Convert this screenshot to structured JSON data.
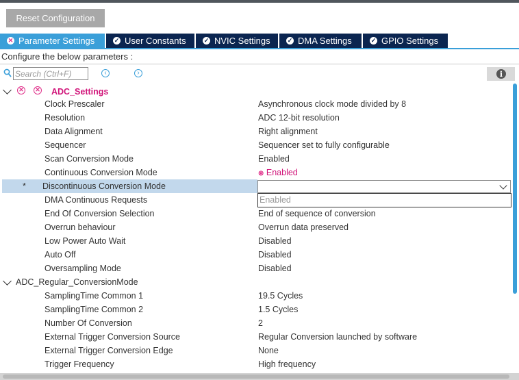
{
  "toolbar": {
    "reset_label": "Reset Configuration"
  },
  "tabs": [
    {
      "label": "Parameter Settings",
      "status": "error",
      "active": true
    },
    {
      "label": "User Constants",
      "status": "ok"
    },
    {
      "label": "NVIC Settings",
      "status": "ok"
    },
    {
      "label": "DMA Settings",
      "status": "ok"
    },
    {
      "label": "GPIO Settings",
      "status": "ok"
    }
  ],
  "config_label": "Configure the below parameters :",
  "search": {
    "placeholder": "Search (Ctrl+F)"
  },
  "groups": {
    "adc_settings": {
      "title": "ADC_Settings",
      "rows": [
        {
          "label": "Clock Prescaler",
          "value": "Asynchronous clock mode divided by 8"
        },
        {
          "label": "Resolution",
          "value": "ADC 12-bit resolution"
        },
        {
          "label": "Data Alignment",
          "value": "Right alignment"
        },
        {
          "label": "Sequencer",
          "value": "Sequencer set to fully configurable"
        },
        {
          "label": "Scan Conversion Mode",
          "value": "Enabled"
        },
        {
          "label": "Continuous Conversion Mode",
          "value": "Enabled"
        },
        {
          "label": "Discontinuous Conversion Mode",
          "value": "",
          "modified_marker": "*"
        },
        {
          "label": "DMA Continuous Requests",
          "value": ""
        },
        {
          "label": "End Of Conversion Selection",
          "value": "End of sequence of conversion"
        },
        {
          "label": "Overrun behaviour",
          "value": "Overrun data preserved"
        },
        {
          "label": "Low Power Auto Wait",
          "value": "Disabled"
        },
        {
          "label": "Auto Off",
          "value": "Disabled"
        },
        {
          "label": "Oversampling Mode",
          "value": "Disabled"
        }
      ]
    },
    "adc_regular": {
      "title": "ADC_Regular_ConversionMode",
      "rows": [
        {
          "label": "SamplingTime Common 1",
          "value": "19.5 Cycles"
        },
        {
          "label": "SamplingTime Common 2",
          "value": "1.5 Cycles"
        },
        {
          "label": "Number Of Conversion",
          "value": "2"
        },
        {
          "label": "External Trigger Conversion Source",
          "value": "Regular Conversion launched by software"
        },
        {
          "label": "External Trigger Conversion Edge",
          "value": "None"
        },
        {
          "label": "Trigger Frequency",
          "value": "High frequency"
        }
      ]
    }
  },
  "dropdown": {
    "option": "Enabled"
  },
  "colors": {
    "accent": "#3a9fd9",
    "tab_bg": "#0b2550",
    "error": "#e0308a",
    "selected_row": "#c2d8ec"
  }
}
